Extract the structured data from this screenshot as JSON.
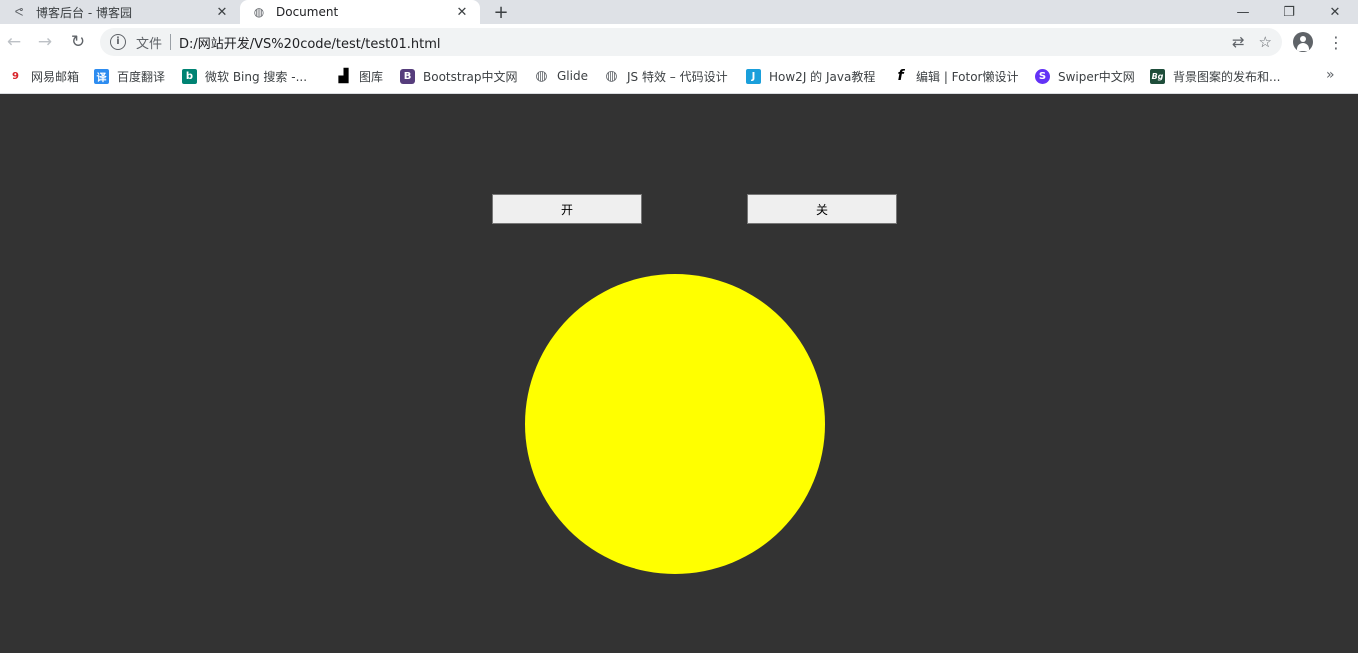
{
  "tabs": [
    {
      "title": "博客后台 - 博客园",
      "icon": "cnblogs-icon",
      "active": false
    },
    {
      "title": "Document",
      "icon": "globe-icon",
      "active": true
    }
  ],
  "omnibox": {
    "scheme_label": "文件",
    "url": "D:/网站开发/VS%20code/test/test01.html"
  },
  "bookmarks": [
    {
      "label": "网易邮箱",
      "icon": "netease-mail-icon",
      "color": "#d8232a",
      "glyph": "9"
    },
    {
      "label": "百度翻译",
      "icon": "baidu-translate-icon",
      "color": "#2d8cf0",
      "glyph": "译"
    },
    {
      "label": "微软 Bing 搜索 -...",
      "icon": "bing-icon",
      "color": "#008373",
      "glyph": "b"
    },
    {
      "label": "图库",
      "icon": "gallery-icon",
      "color": "#000000",
      "glyph": "▟"
    },
    {
      "label": "Bootstrap中文网",
      "icon": "bootstrap-icon",
      "color": "#563d7c",
      "glyph": "B"
    },
    {
      "label": "Glide",
      "icon": "globe-icon",
      "color": "#5f6368",
      "glyph": "◍"
    },
    {
      "label": "JS 特效 – 代码设计",
      "icon": "globe-icon",
      "color": "#5f6368",
      "glyph": "◍"
    },
    {
      "label": "How2J 的 Java教程",
      "icon": "how2j-icon",
      "color": "#1a9fdb",
      "glyph": "J"
    },
    {
      "label": "编辑 | Fotor懒设计",
      "icon": "fotor-icon",
      "color": "#000000",
      "glyph": "f"
    },
    {
      "label": "Swiper中文网",
      "icon": "swiper-icon",
      "color": "#6332f6",
      "glyph": "S"
    },
    {
      "label": "背景图案的发布和...",
      "icon": "bg-pattern-icon",
      "color": "#1e4d3a",
      "glyph": "Bg"
    }
  ],
  "page": {
    "on_label": "开",
    "off_label": "关",
    "bulb_color": "#ffff00",
    "background_color": "#333333"
  }
}
